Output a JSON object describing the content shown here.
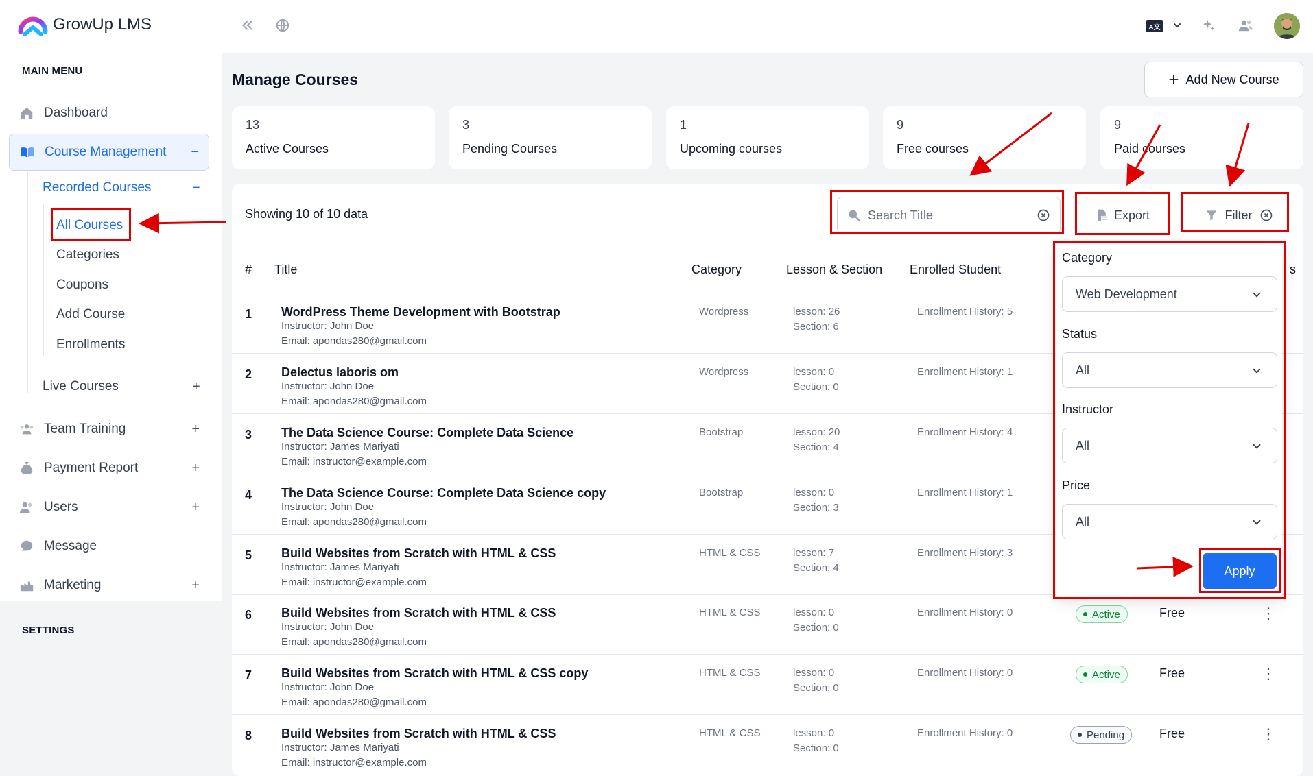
{
  "app": {
    "brand": "GrowUp LMS",
    "lang_code": "A文"
  },
  "sidebar": {
    "main_menu": "MAIN MENU",
    "settings": "SETTINGS",
    "items": [
      {
        "label": "Dashboard",
        "toggle": ""
      },
      {
        "label": "Course Management",
        "toggle": "−"
      },
      {
        "label": "Team Training",
        "toggle": "+"
      },
      {
        "label": "Payment Report",
        "toggle": "+"
      },
      {
        "label": "Users",
        "toggle": "+"
      },
      {
        "label": "Message",
        "toggle": ""
      },
      {
        "label": "Marketing",
        "toggle": "+"
      }
    ],
    "recorded_courses": {
      "label": "Recorded Courses",
      "toggle": "−"
    },
    "sub_items": [
      "All Courses",
      "Categories",
      "Coupons",
      "Add Course",
      "Enrollments"
    ],
    "live_courses": {
      "label": "Live Courses",
      "toggle": "+"
    }
  },
  "main": {
    "title": "Manage Courses",
    "add_button": "Add New Course",
    "add_plus": "+",
    "stats": [
      {
        "num": "13",
        "label": "Active Courses"
      },
      {
        "num": "3",
        "label": "Pending Courses"
      },
      {
        "num": "1",
        "label": "Upcoming courses"
      },
      {
        "num": "9",
        "label": "Free courses"
      },
      {
        "num": "9",
        "label": "Paid courses"
      }
    ],
    "showing": "Showing 10 of 10 data",
    "search_placeholder": "Search Title",
    "export_label": "Export",
    "filter_label": "Filter"
  },
  "table": {
    "headers": {
      "idx": "#",
      "title": "Title",
      "category": "Category",
      "lesson": "Lesson & Section",
      "enrolled": "Enrolled Student",
      "tail": "s"
    },
    "rows": [
      {
        "idx": "1",
        "title": "WordPress Theme Development with Bootstrap",
        "instructor": "Instructor: John Doe",
        "email": "Email: apondas280@gmail.com",
        "category": "Wordpress",
        "lesson": "lesson: 26",
        "section": "Section: 6",
        "enroll": "Enrollment History: 5",
        "status": "",
        "price": ""
      },
      {
        "idx": "2",
        "title": "Delectus laboris om",
        "instructor": "Instructor: John Doe",
        "email": "Email: apondas280@gmail.com",
        "category": "Wordpress",
        "lesson": "lesson: 0",
        "section": "Section: 0",
        "enroll": "Enrollment History: 1",
        "status": "",
        "price": ""
      },
      {
        "idx": "3",
        "title": "The Data Science Course: Complete Data Science",
        "instructor": "Instructor: James Mariyati",
        "email": "Email: instructor@example.com",
        "category": "Bootstrap",
        "lesson": "lesson: 20",
        "section": "Section: 4",
        "enroll": "Enrollment History: 4",
        "status": "",
        "price": ""
      },
      {
        "idx": "4",
        "title": "The Data Science Course: Complete Data Science copy",
        "instructor": "Instructor: John Doe",
        "email": "Email: apondas280@gmail.com",
        "category": "Bootstrap",
        "lesson": "lesson: 0",
        "section": "Section: 3",
        "enroll": "Enrollment History: 1",
        "status": "",
        "price": ""
      },
      {
        "idx": "5",
        "title": "Build Websites from Scratch with HTML & CSS",
        "instructor": "Instructor: James Mariyati",
        "email": "Email: instructor@example.com",
        "category": "HTML & CSS",
        "lesson": "lesson: 7",
        "section": "Section: 4",
        "enroll": "Enrollment History: 3",
        "status": "",
        "price": ""
      },
      {
        "idx": "6",
        "title": "Build Websites from Scratch with HTML & CSS",
        "instructor": "Instructor: John Doe",
        "email": "Email: apondas280@gmail.com",
        "category": "HTML & CSS",
        "lesson": "lesson: 0",
        "section": "Section: 0",
        "enroll": "Enrollment History: 0",
        "status": "Active",
        "price": "Free"
      },
      {
        "idx": "7",
        "title": "Build Websites from Scratch with HTML & CSS copy",
        "instructor": "Instructor: John Doe",
        "email": "Email: apondas280@gmail.com",
        "category": "HTML & CSS",
        "lesson": "lesson: 0",
        "section": "Section: 0",
        "enroll": "Enrollment History: 0",
        "status": "Active",
        "price": "Free"
      },
      {
        "idx": "8",
        "title": "Build Websites from Scratch with HTML & CSS",
        "instructor": "Instructor: James Mariyati",
        "email": "Email: instructor@example.com",
        "category": "HTML & CSS",
        "lesson": "lesson: 0",
        "section": "Section: 0",
        "enroll": "Enrollment History: 0",
        "status": "Pending",
        "price": "Free"
      }
    ]
  },
  "filter_panel": {
    "category_label": "Category",
    "category_value": "Web Development",
    "status_label": "Status",
    "status_value": "All",
    "instructor_label": "Instructor",
    "instructor_value": "All",
    "price_label": "Price",
    "price_value": "All",
    "apply_label": "Apply"
  },
  "colors": {
    "accent": "#1d6ff2",
    "annotation": "#e00000",
    "active_green": "#15803d"
  }
}
